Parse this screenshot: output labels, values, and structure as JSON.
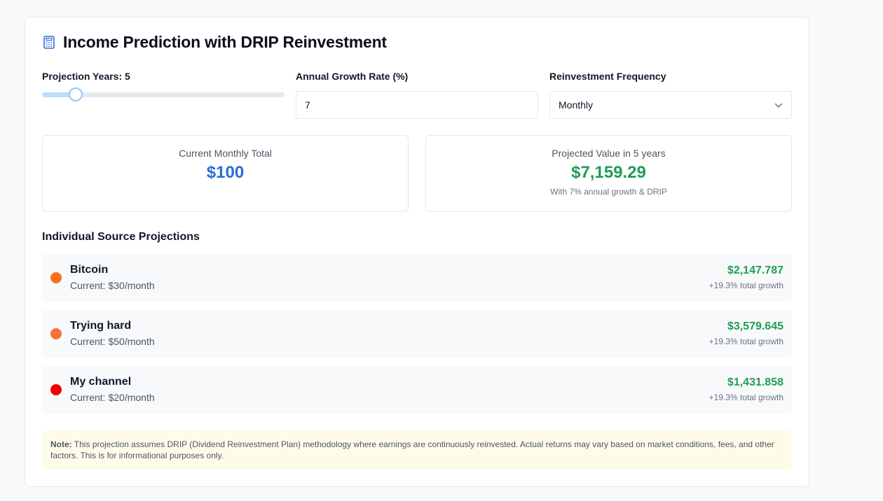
{
  "header": {
    "title": "Income Prediction with DRIP Reinvestment",
    "icon": "calculator-icon"
  },
  "controls": {
    "years_label": "Projection Years: 5",
    "years_value": 5,
    "years_min": 1,
    "years_max": 30,
    "growth_label": "Annual Growth Rate (%)",
    "growth_value": "7",
    "frequency_label": "Reinvestment Frequency",
    "frequency_value": "Monthly"
  },
  "summary": {
    "current_label": "Current Monthly Total",
    "current_value": "$100",
    "projected_label": "Projected Value in 5 years",
    "projected_value": "$7,159.29",
    "projected_sub": "With 7% annual growth & DRIP"
  },
  "sources": {
    "title": "Individual Source Projections",
    "items": [
      {
        "name": "Bitcoin",
        "current": "Current: $30/month",
        "value": "$2,147.787",
        "growth": "+19.3% total growth",
        "color": "#f97316"
      },
      {
        "name": "Trying hard",
        "current": "Current: $50/month",
        "value": "$3,579.645",
        "growth": "+19.3% total growth",
        "color": "#f8713a"
      },
      {
        "name": "My channel",
        "current": "Current: $20/month",
        "value": "$1,431.858",
        "growth": "+19.3% total growth",
        "color": "#ee0000"
      }
    ]
  },
  "note": {
    "label": "Note:",
    "text": "This projection assumes DRIP (Dividend Reinvestment Plan) methodology where earnings are continuously reinvested. Actual returns may vary based on market conditions, fees, and other factors. This is for informational purposes only."
  },
  "colors": {
    "accent_blue": "#2b6cd8",
    "accent_green": "#1f9d55",
    "note_bg": "#fefce8"
  }
}
